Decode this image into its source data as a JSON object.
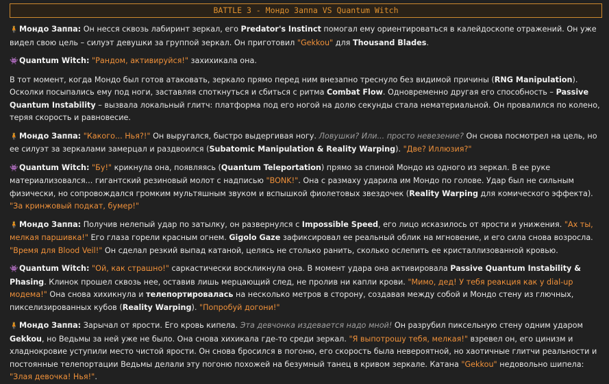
{
  "header": {
    "title": "BATTLE 3 - Мондо Заппа VS Quantum Witch"
  },
  "icons": {
    "mondo": "🧍",
    "witch": "👾"
  },
  "p1": {
    "speaker": "Мондо Заппа:",
    "t1": " Он несся сквозь лабиринт зеркал, его ",
    "b1": "Predator's Instinct",
    "t2": " помогал ему ориентироваться в калейдоскопе отражений. Он уже видел свою цель – силуэт девушки за группой зеркал. Он приготовил ",
    "q1": "\"Gekkou\"",
    "t3": " для ",
    "b2": "Thousand Blades",
    "t4": "."
  },
  "p2": {
    "speaker": "Quantum Witch:",
    "q1": " \"Рандом, активируйся!\"",
    "t1": " захихикала она."
  },
  "p3": {
    "t1": "В тот момент, когда Мондо был готов атаковать, зеркало прямо перед ним внезапно треснуло без видимой причины (",
    "b1": "RNG Manipulation",
    "t2": "). Осколки посыпались ему под ноги, заставляя споткнуться и сбиться с ритма ",
    "b2": "Combat Flow",
    "t3": ". Одновременно другая его способность – ",
    "b3": "Passive Quantum Instability",
    "t4": " – вызвала локальный глитч: платформа под его ногой на долю секунды стала нематериальной. Он провалился по колено, теряя скорость и равновесие."
  },
  "p4": {
    "speaker": "Мондо Заппа:",
    "q1": " \"Какого... Нья?!\"",
    "t1": " Он выругался, быстро выдергивая ногу. ",
    "i1": "Ловушки? Или... просто невезение?",
    "t2": " Он снова посмотрел на цель, но ее силуэт за зеркалами замерцал и раздвоился (",
    "b1": "Subatomic Manipulation & Reality Warping",
    "t3": "). ",
    "q2": "\"Две? Иллюзия?\""
  },
  "p5": {
    "speaker": "Quantum Witch:",
    "q1": " \"Бу!\"",
    "t1": " крикнула она, появляясь (",
    "b1": "Quantum Teleportation",
    "t2": ") прямо за спиной Мондо из одного из зеркал. В ее руке материализовался... гигантский резиновый молот с надписью ",
    "q2": "\"BONK!\"",
    "t3": ". Она с размаху ударила им Мондо по голове. Удар был не сильным физически, но сопровождался громким мультяшным звуком и вспышкой фиолетовых звездочек (",
    "b2": "Reality Warping",
    "t4": " для комического эффекта). ",
    "q3": "\"За кринжовый подкат, бумер!\""
  },
  "p6": {
    "speaker": "Мондо Заппа:",
    "t1": " Получив нелепый удар по затылку, он развернулся с ",
    "b1": "Impossible Speed",
    "t2": ", его лицо исказилось от ярости и унижения. ",
    "q1": "\"Ах ты, мелкая паршивка!\"",
    "t3": " Его глаза горели красным огнем. ",
    "b2": "Gigolo Gaze",
    "t4": " зафиксировал ее реальный облик на мгновение, и его сила снова возросла. ",
    "q2": "\"Время для Blood Veil!\"",
    "t5": " Он сделал резкий выпад катаной, целясь не столько ранить, сколько ослепить ее кристаллизованной кровью."
  },
  "p7": {
    "speaker": "Quantum Witch:",
    "q1": " \"Ой, как страшно!\"",
    "t1": " саркастически воскликнула она. В момент удара она активировала ",
    "b1": "Passive Quantum Instability & Phasing",
    "t2": ". Клинок прошел сквозь нее, оставив лишь мерцающий след, не пролив ни капли крови. ",
    "q2": "\"Мимо, дед! У тебя реакция как у dial-up модема!\"",
    "t3": " Она снова хихикнула и ",
    "b2": "телепортировалась",
    "t4": " на несколько метров в сторону, создавая между собой и Мондо стену из глючных, пикселизированных кубов (",
    "b3": "Reality Warping",
    "t5": "). ",
    "q3": "\"Попробуй догони!\""
  },
  "p8": {
    "speaker": "Мондо Заппа:",
    "t1": " Зарычал от ярости. Его кровь кипела. ",
    "i1": "Эта девчонка издевается надо мной!",
    "t2": " Он разрубил пиксельную стену одним ударом ",
    "b1": "Gekkou",
    "t3": ", но Ведьмы за ней уже не было. Она снова хихикала где-то среди зеркал. ",
    "q1": "\"Я выпотрошу тебя, мелкая!\"",
    "t4": " взревел он, его цинизм и хладнокровие уступили место чистой ярости. Он снова бросился в погоню, его скорость была невероятной, но хаотичные глитчи реальности и постоянные телепортации Ведьмы делали эту погоню похожей на безумный танец в кривом зеркале. Катана ",
    "q2": "\"Gekkou\"",
    "t5": " недовольно шипела: ",
    "q3": "\"Злая девочка! Нья!\"",
    "t6": "."
  }
}
